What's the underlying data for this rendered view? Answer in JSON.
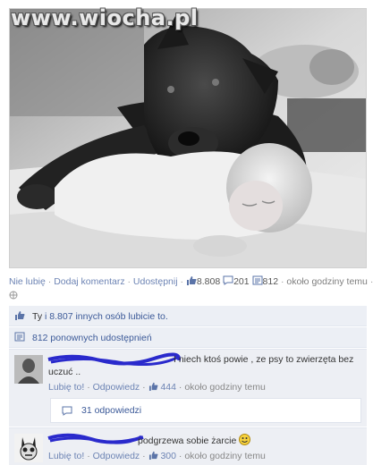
{
  "watermark": "www.wiocha.pl",
  "post": {
    "actions": {
      "unlike": "Nie lubię",
      "comment": "Dodaj komentarz",
      "share": "Udostępnij",
      "like_count": "8.808",
      "comment_count": "201",
      "share_count": "812",
      "time": "około godziny temu"
    },
    "likes_summary": {
      "you": "Ty",
      "rest": " i 8.807 innych osób lubicie to."
    },
    "shares_summary": "812 ponownych udostępnień"
  },
  "comments": [
    {
      "text": "I niech ktoś powie , ze psy to zwierzęta bez uczuć ..",
      "like": "Lubię to!",
      "reply": "Odpowiedz",
      "likes": "444",
      "time": "około godziny temu",
      "replies": "31 odpowiedzi"
    },
    {
      "text": "podgrzewa sobie żarcie",
      "like": "Lubię to!",
      "reply": "Odpowiedz",
      "likes": "300",
      "time": "około godziny temu"
    }
  ],
  "colors": {
    "link": "#3b5998",
    "link_muted": "#6d84b4",
    "panel": "#eceff5",
    "scribble": "#2a2acc"
  },
  "icons": [
    "thumbs-up-icon",
    "comment-icon",
    "share-icon",
    "globe-icon",
    "smiley-icon"
  ]
}
